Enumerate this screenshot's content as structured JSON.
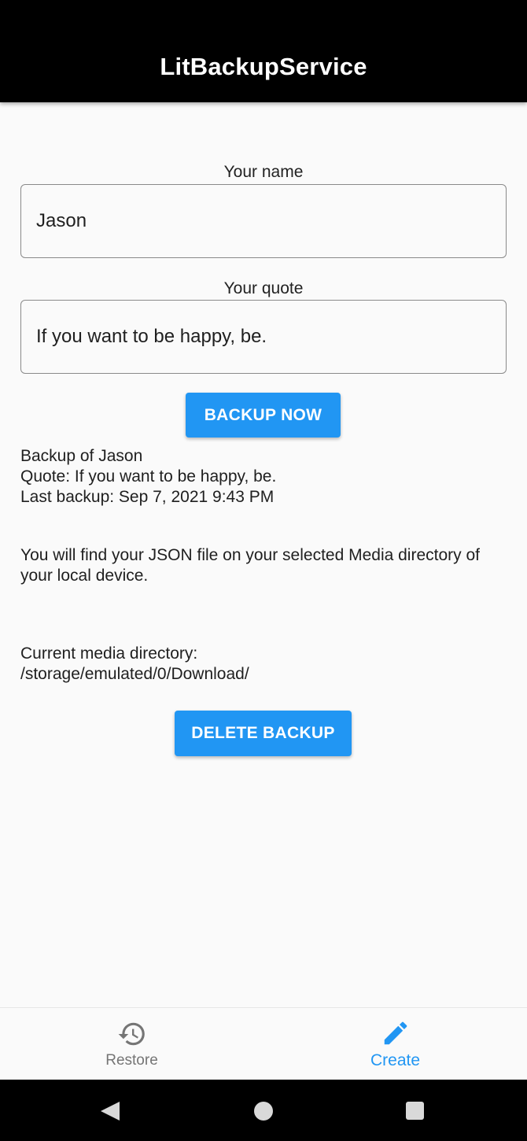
{
  "app_bar": {
    "title": "LitBackupService"
  },
  "form": {
    "name_label": "Your name",
    "name_value": "Jason",
    "quote_label": "Your quote",
    "quote_value": "If you want to be happy, be."
  },
  "actions": {
    "backup_label": "BACKUP NOW",
    "delete_label": "DELETE BACKUP"
  },
  "backup_info": {
    "line1": "Backup of Jason",
    "line2": "Quote: If you want to be happy, be.",
    "line3": "Last backup: Sep 7, 2021 9:43 PM"
  },
  "info_text": "You will find your JSON file on your selected Media directory of your local device.",
  "media_dir": {
    "label": "Current media directory:",
    "path": "/storage/emulated/0/Download/"
  },
  "bottom_nav": {
    "items": [
      {
        "label": "Restore",
        "icon": "history-icon",
        "active": false
      },
      {
        "label": "Create",
        "icon": "pencil-icon",
        "active": true
      }
    ]
  },
  "colors": {
    "accent": "#2196f3",
    "app_bar": "#000000",
    "inactive": "#757575"
  },
  "system_nav": {
    "icons": [
      "back-icon",
      "home-icon",
      "recents-icon"
    ]
  }
}
